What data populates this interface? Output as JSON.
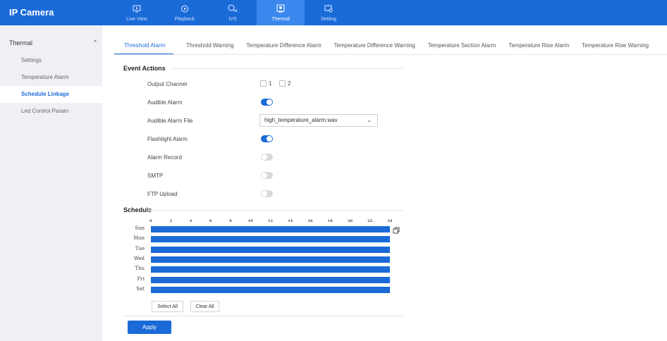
{
  "app": {
    "title": "IP Camera"
  },
  "nav": [
    {
      "label": "Live View",
      "icon": "live-view-icon"
    },
    {
      "label": "Playback",
      "icon": "playback-icon"
    },
    {
      "label": "IVS",
      "icon": "ivs-icon"
    },
    {
      "label": "Thermal",
      "icon": "thermal-icon",
      "active": true
    },
    {
      "label": "Setting",
      "icon": "setting-icon"
    }
  ],
  "sidebar": {
    "group": "Thermal",
    "items": [
      {
        "label": "Settings"
      },
      {
        "label": "Temperature Alarm"
      },
      {
        "label": "Schedule Linkage",
        "active": true
      },
      {
        "label": "Led Control Param"
      }
    ]
  },
  "tabs": [
    {
      "label": "Threshold Alarm",
      "active": true
    },
    {
      "label": "Threshold Warning"
    },
    {
      "label": "Temperature Difference Alarm"
    },
    {
      "label": "Temperature Difference Warning"
    },
    {
      "label": "Temperature Section Alarm"
    },
    {
      "label": "Temperature Rise Alarm"
    },
    {
      "label": "Temperature Rise Warning"
    }
  ],
  "event_actions": {
    "title": "Event Actions",
    "output_channel": {
      "label": "Output Channel",
      "options": [
        "1",
        "2"
      ]
    },
    "audible_alarm": {
      "label": "Audible Alarm",
      "on": true
    },
    "audible_alarm_file": {
      "label": "Audible Alarm File",
      "value": "high_temperature_alarm.wav"
    },
    "flashlight_alarm": {
      "label": "Flashlight Alarm",
      "on": true
    },
    "alarm_record": {
      "label": "Alarm Record",
      "on": false
    },
    "smtp": {
      "label": "SMTP",
      "on": false
    },
    "ftp_upload": {
      "label": "FTP Upload",
      "on": false
    }
  },
  "schedule": {
    "title": "Schedule",
    "hours": [
      "0",
      "2",
      "4",
      "6",
      "8",
      "10",
      "12",
      "14",
      "16",
      "18",
      "20",
      "22",
      "24"
    ],
    "days": [
      "Sun",
      "Mon",
      "Tue",
      "Wed",
      "Thu",
      "Fri",
      "Sat"
    ],
    "select_all": "Select All",
    "clear_all": "Clear All"
  },
  "apply_label": "Apply",
  "colors": {
    "accent": "#1a6ad8",
    "topbar": "#1a6ad8",
    "sidebar_bg": "#eef0f4"
  }
}
